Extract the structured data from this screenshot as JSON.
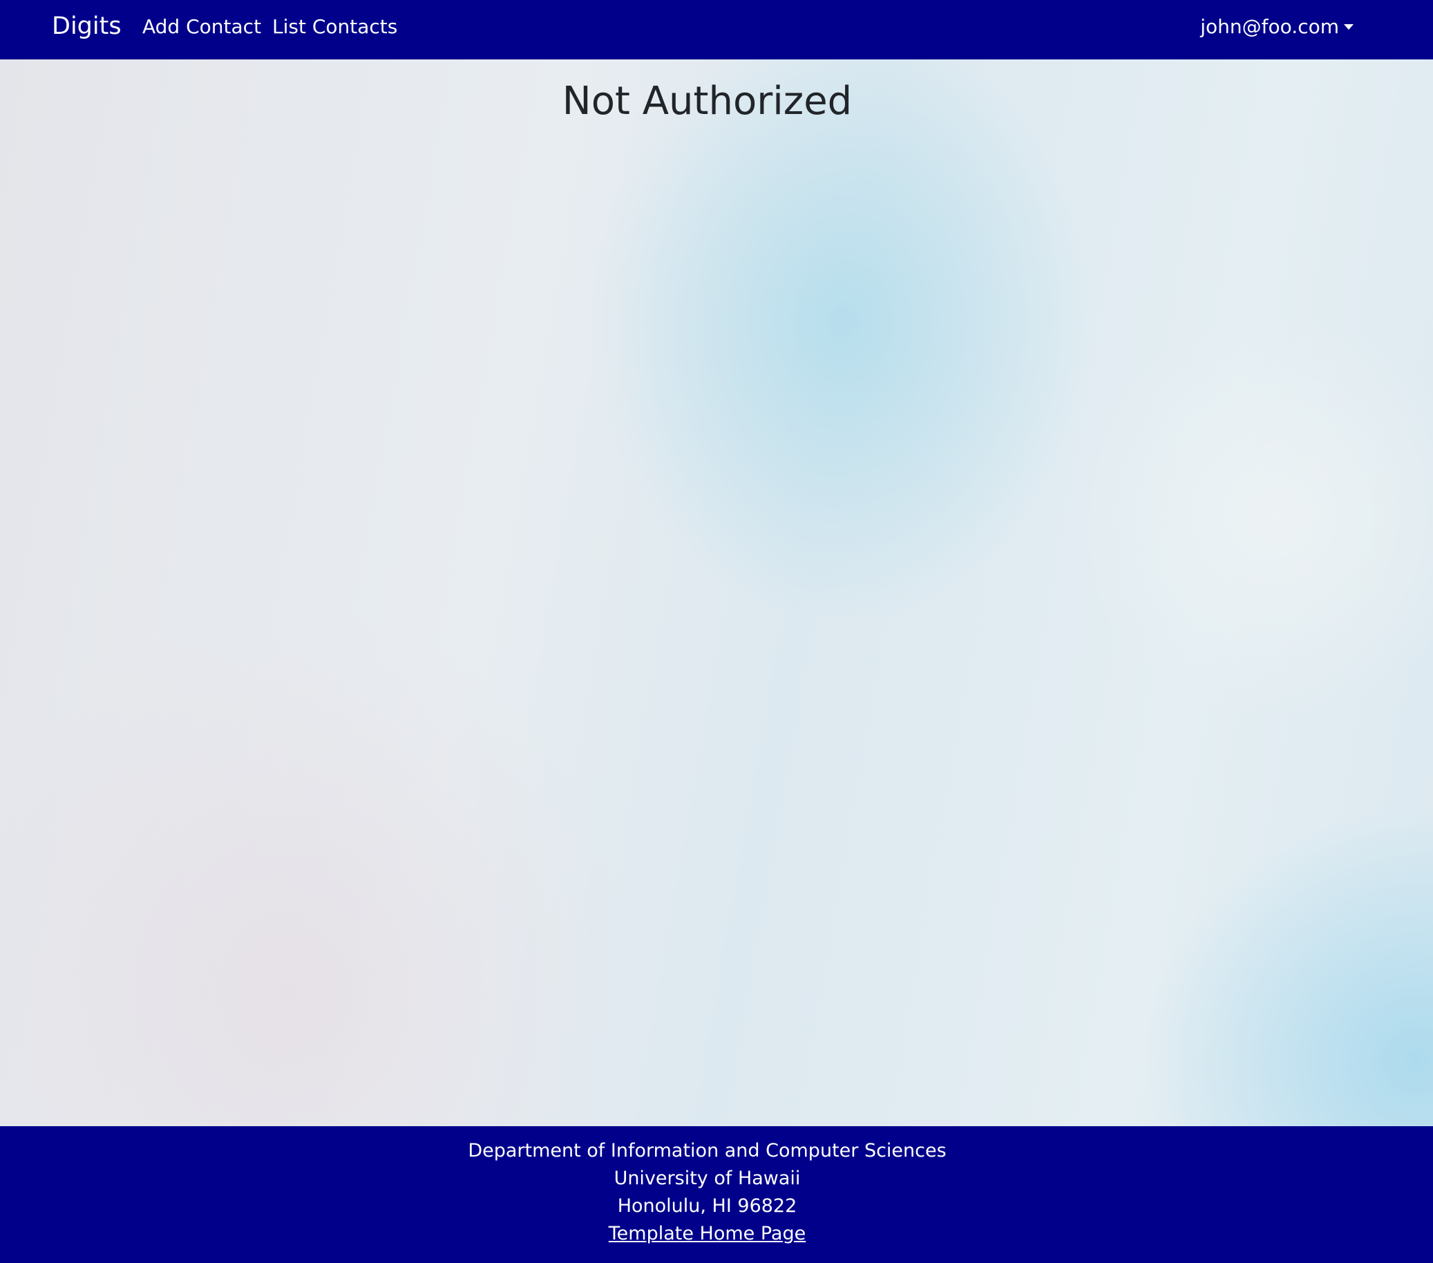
{
  "navbar": {
    "brand": "Digits",
    "links": [
      {
        "label": "Add Contact"
      },
      {
        "label": "List Contacts"
      }
    ],
    "user_menu": {
      "label": "john@foo.com"
    },
    "background_color": "#00008b"
  },
  "main": {
    "title": "Not Authorized"
  },
  "footer": {
    "lines": [
      "Department of Information and Computer Sciences",
      "University of Hawaii",
      "Honolulu, HI 96822"
    ],
    "link_label": "Template Home Page",
    "background_color": "#00008b"
  }
}
